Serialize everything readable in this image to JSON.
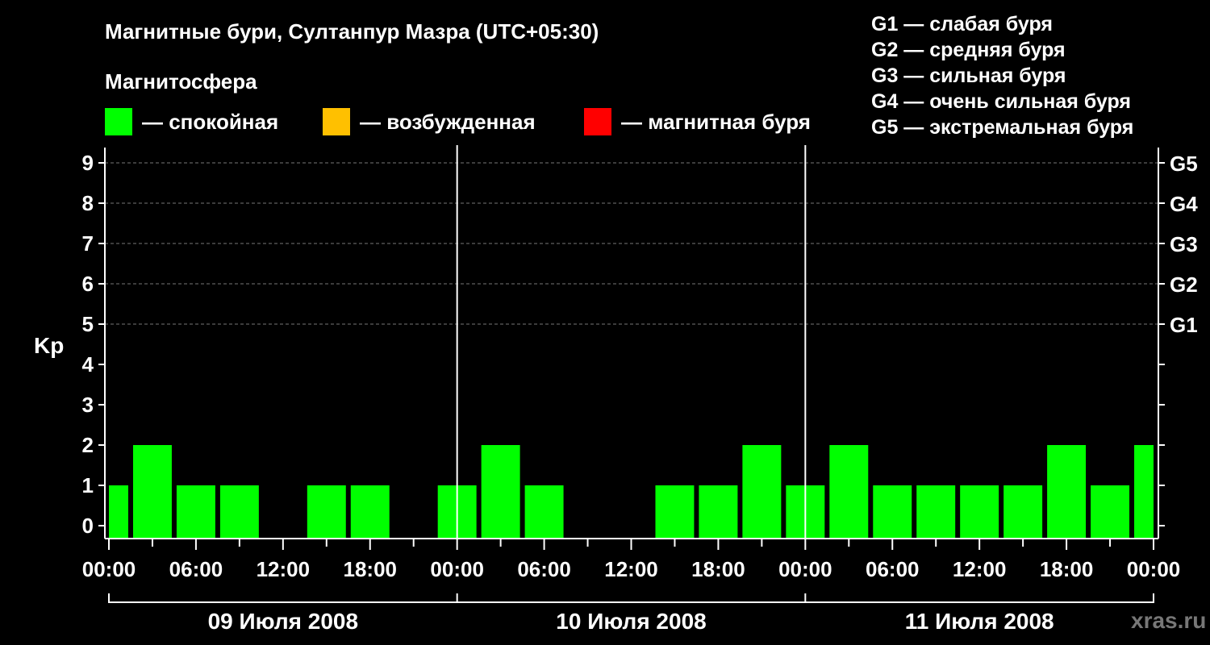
{
  "header": {
    "title": "Магнитные бури, Султанпур Мазра (UTC+05:30)",
    "subtitle": "Магнитосфера"
  },
  "legend": [
    {
      "label": "— спокойная",
      "color": "#00ff00"
    },
    {
      "label": "— возбужденная",
      "color": "#ffc000"
    },
    {
      "label": "— магнитная буря",
      "color": "#ff0000"
    }
  ],
  "storm_levels": [
    "G1 — слабая буря",
    "G2 — средняя буря",
    "G3 — сильная буря",
    "G4 — очень сильная буря",
    "G5 — экстремальная буря"
  ],
  "watermark": "xras.ru",
  "chart_data": {
    "type": "bar",
    "ylabel": "Kp",
    "ylim": [
      0,
      9
    ],
    "yticks": [
      "0",
      "1",
      "2",
      "3",
      "4",
      "5",
      "6",
      "7",
      "8",
      "9"
    ],
    "right_ticks": [
      {
        "label": "G1",
        "value": 5
      },
      {
        "label": "G2",
        "value": 6
      },
      {
        "label": "G3",
        "value": 7
      },
      {
        "label": "G4",
        "value": 8
      },
      {
        "label": "G5",
        "value": 9
      }
    ],
    "x_tick_labels": [
      "00:00",
      "06:00",
      "12:00",
      "18:00",
      "00:00",
      "06:00",
      "12:00",
      "18:00",
      "00:00",
      "06:00",
      "12:00",
      "18:00",
      "00:00"
    ],
    "days": [
      "09 Июля 2008",
      "10 Июля 2008",
      "11 Июля 2008"
    ],
    "interval_hours": 3,
    "start_hour": -1.5,
    "values": [
      1,
      2,
      1,
      1,
      0,
      1,
      1,
      0,
      1,
      2,
      1,
      0,
      0,
      1,
      1,
      2,
      1,
      2,
      1,
      1,
      1,
      1,
      2,
      1,
      2
    ],
    "colors": {
      "calm": "#00ff00",
      "active": "#ffc000",
      "storm": "#ff0000"
    },
    "grid": true
  }
}
